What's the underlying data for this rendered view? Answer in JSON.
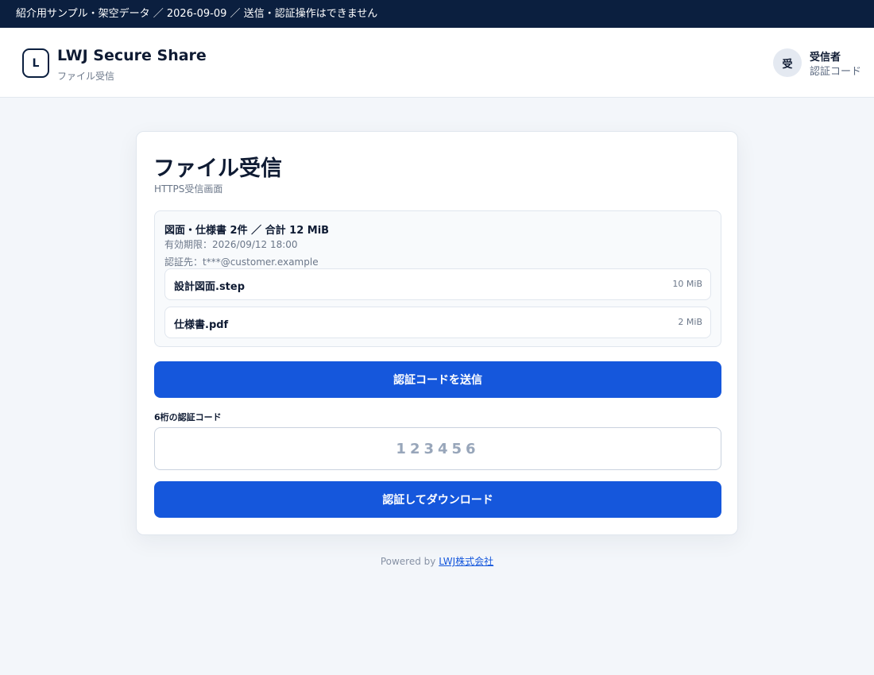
{
  "banner": {
    "text": "紹介用サンプル・架空データ ／ 2026-09-09 ／ 送信・認証操作はできません"
  },
  "header": {
    "logo_letter": "L",
    "title": "LWJ Secure Share",
    "subtitle": "ファイル受信",
    "avatar_char": "受",
    "user_name": "受信者",
    "user_role": "認証コード"
  },
  "card": {
    "title": "ファイル受信",
    "subtitle": "HTTPS受信画面",
    "summary": {
      "title": "図面・仕様書 2件 ／ 合計 12 MiB",
      "expiry": "有効期限：2026/09/12 18:00",
      "auth_target": "認証先：t***@customer.example"
    },
    "files": [
      {
        "name": "設計図面.step",
        "size": "10 MiB"
      },
      {
        "name": "仕様書.pdf",
        "size": "2 MiB"
      }
    ],
    "send_button": "認証コードを送信",
    "code_label": "6桁の認証コード",
    "code_placeholder": "123456",
    "download_button": "認証してダウンロード"
  },
  "footer": {
    "prefix": "Powered by ",
    "link": "LWJ株式会社"
  },
  "colors": {
    "banner_bg": "#0b1f3f",
    "primary": "#1557dc",
    "page_bg": "#f3f6fa"
  }
}
